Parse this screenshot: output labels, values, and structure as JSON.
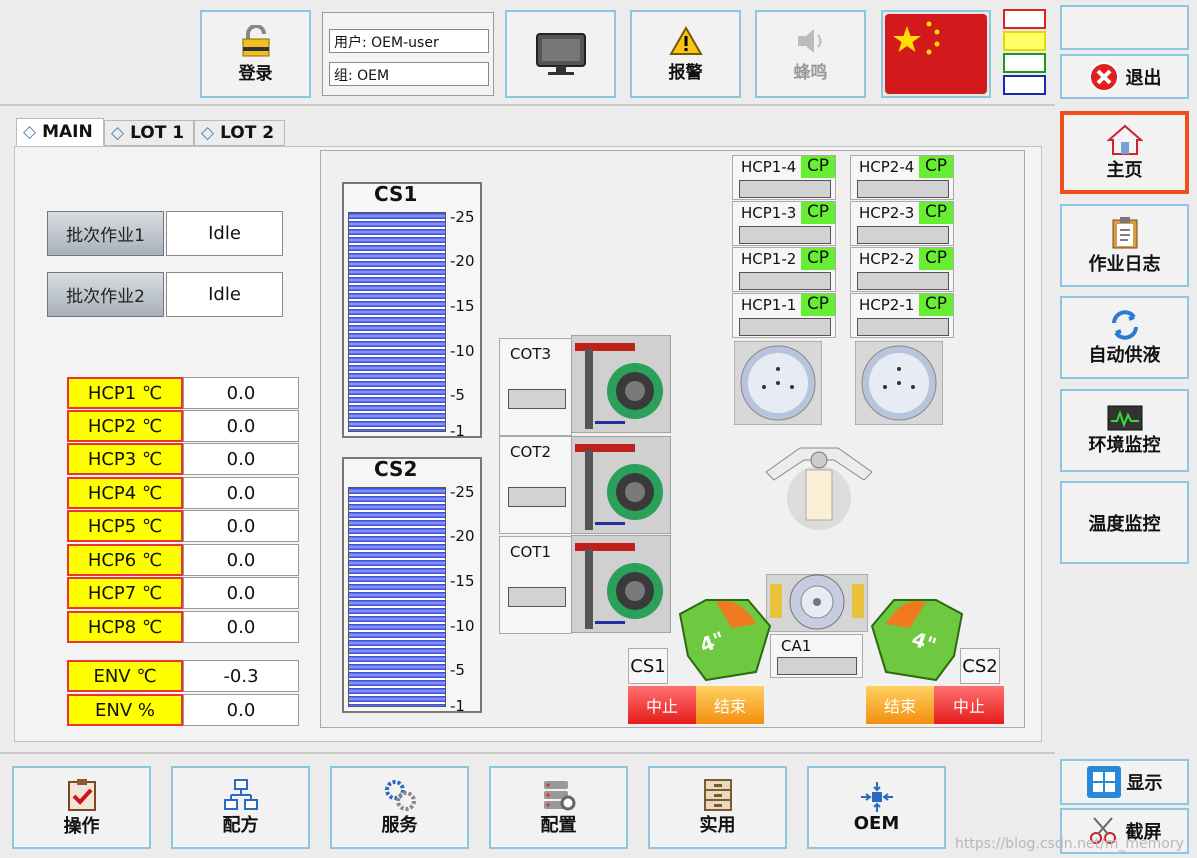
{
  "toolbar": {
    "login": "登录",
    "user": "用户: OEM-user",
    "group": "组: OEM",
    "alarm": "报警",
    "buzzer": "蜂鸣",
    "exit": "退出"
  },
  "tabs": [
    "MAIN",
    "LOT 1",
    "LOT 2"
  ],
  "batches": [
    {
      "label": "批次作业1",
      "status": "Idle"
    },
    {
      "label": "批次作业2",
      "status": "Idle"
    }
  ],
  "temps": [
    {
      "label": "HCP1 ℃",
      "value": "0.0"
    },
    {
      "label": "HCP2 ℃",
      "value": "0.0"
    },
    {
      "label": "HCP3 ℃",
      "value": "0.0"
    },
    {
      "label": "HCP4 ℃",
      "value": "0.0"
    },
    {
      "label": "HCP5 ℃",
      "value": "0.0"
    },
    {
      "label": "HCP6 ℃",
      "value": "0.0"
    },
    {
      "label": "HCP7 ℃",
      "value": "0.0"
    },
    {
      "label": "HCP8 ℃",
      "value": "0.0"
    }
  ],
  "env": [
    {
      "label": "ENV ℃",
      "value": "-0.3"
    },
    {
      "label": "ENV %",
      "value": "0.0"
    }
  ],
  "cassettes": {
    "cs1": "CS1",
    "cs2": "CS2",
    "ticks": [
      "-25",
      "-20",
      "-15",
      "-10",
      "-5",
      "-1"
    ]
  },
  "cot": [
    "COT3",
    "COT2",
    "COT1"
  ],
  "hcp_left": [
    "HCP1-4",
    "HCP1-3",
    "HCP1-2",
    "HCP1-1"
  ],
  "hcp_right": [
    "HCP2-4",
    "HCP2-3",
    "HCP2-2",
    "HCP2-1"
  ],
  "cp": "CP",
  "ca1": "CA1",
  "ports": {
    "cs1": "CS1",
    "cs2": "CS2",
    "stop": "中止",
    "end": "结束",
    "size": "4\""
  },
  "side": {
    "home": "主页",
    "log": "作业日志",
    "supply": "自动供液",
    "env": "环境监控",
    "temp": "温度监控",
    "display": "显示",
    "screenshot": "截屏"
  },
  "bottom": [
    "操作",
    "配方",
    "服务",
    "配置",
    "实用",
    "OEM"
  ],
  "watermark": "https://blog.csdn.net/m_memory"
}
